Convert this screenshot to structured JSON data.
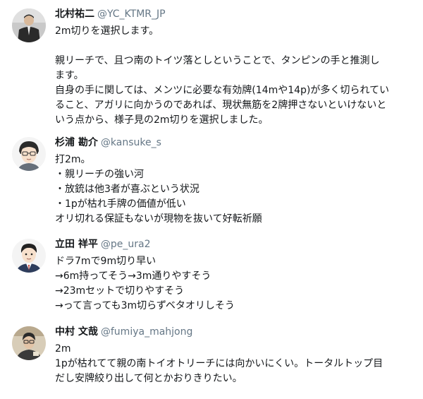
{
  "posts": [
    {
      "name": "北村祐二",
      "handle": "@YC_KTMR_JP",
      "lines": [
        "2m切りを選択します。",
        "",
        "親リーチで、且つ南のトイツ落としということで、タンピンの手と推測し",
        "ます。",
        "自身の手に関しては、メンツに必要な有効牌(14mや14p)が多く切られてい",
        "ること、アガリに向かうのであれば、現状無筋を2牌押さないといけないと",
        "いう点から、様子見の2m切りを選択しました。"
      ]
    },
    {
      "name": "杉浦 勘介",
      "handle": "@kansuke_s",
      "lines": [
        "打2m。",
        "・親リーチの強い河",
        "・放銃は他3者が喜ぶという状況",
        "・1pが枯れ手牌の価値が低い",
        "オリ切れる保証もないが現物を抜いて好転祈願"
      ]
    },
    {
      "name": "立田 祥平",
      "handle": "@pe_ura2",
      "lines": [
        "ドラ7mで9m切り早い",
        "→6m持ってそう→3m通りやすそう",
        "→23mセットで切りやすそう",
        "→って言っても3m切らずベタオリしそう"
      ]
    },
    {
      "name": "中村 文哉",
      "handle": "@fumiya_mahjong",
      "lines": [
        "2m",
        "1pが枯れてて親の南トイオトリーチには向かいにくい。トータルトップ目",
        "だし安牌絞り出して何とかおりきりたい。"
      ]
    }
  ]
}
